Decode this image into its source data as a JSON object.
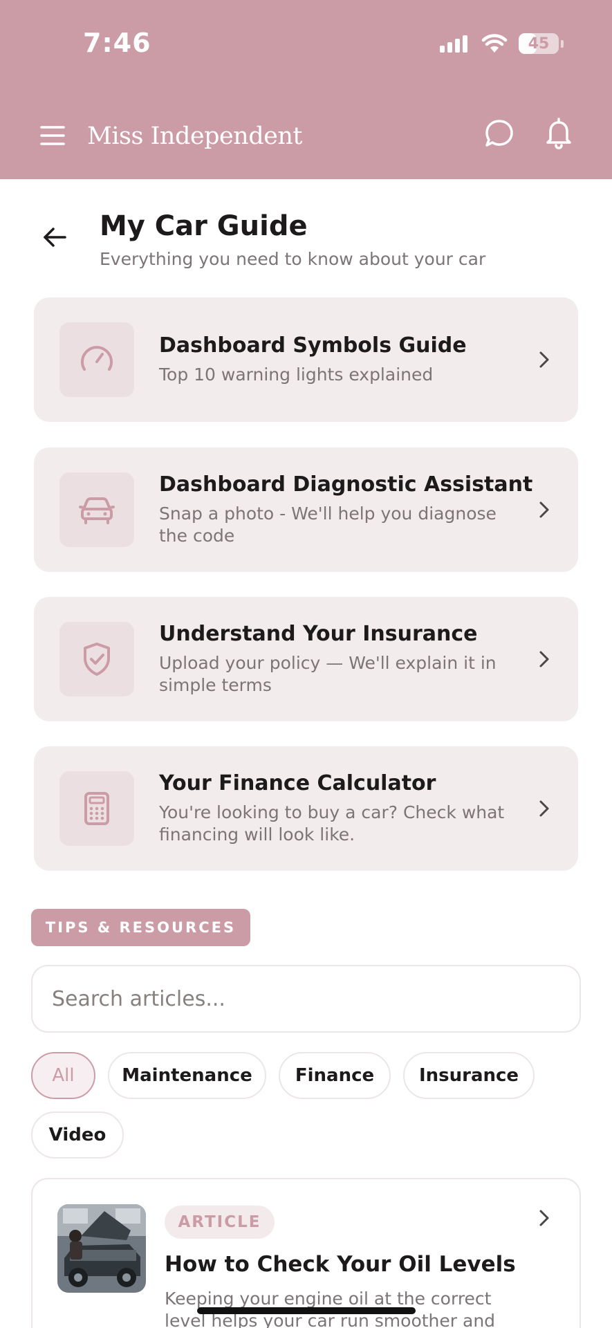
{
  "status_bar": {
    "time": "7:46",
    "battery": "45",
    "battery_level": 0.45
  },
  "header": {
    "app_title": "Miss Independent"
  },
  "page": {
    "title": "My Car Guide",
    "subtitle": "Everything you need to know about your car"
  },
  "cards": [
    {
      "title": "Dashboard Symbols Guide",
      "description": "Top 10 warning lights explained",
      "icon": "speedometer-icon"
    },
    {
      "title": "Dashboard Diagnostic Assistant",
      "description": "Snap a photo - We'll help you diagnose the code",
      "icon": "car-icon"
    },
    {
      "title": "Understand Your Insurance",
      "description": "Upload your policy — We'll explain it in simple terms",
      "icon": "shield-check-icon"
    },
    {
      "title": "Your Finance Calculator",
      "description": "You're looking to buy a car? Check what financing will look like.",
      "icon": "calculator-icon"
    }
  ],
  "resources": {
    "section_label": "TIPS & RESOURCES",
    "search_placeholder": "Search articles...",
    "filters": [
      {
        "label": "All",
        "active": true
      },
      {
        "label": "Maintenance",
        "active": false
      },
      {
        "label": "Finance",
        "active": false
      },
      {
        "label": "Insurance",
        "active": false
      },
      {
        "label": "Video",
        "active": false
      }
    ],
    "articles": [
      {
        "type": "ARTICLE",
        "title": "How to Check Your Oil Levels",
        "excerpt": "Keeping your engine oil at the correct level helps your car run smoother and"
      }
    ]
  },
  "colors": {
    "brand": "#cb9ca6",
    "card_bg": "#f3eced",
    "icon_bg": "#ecdfe2",
    "muted_text": "#7c7577"
  }
}
